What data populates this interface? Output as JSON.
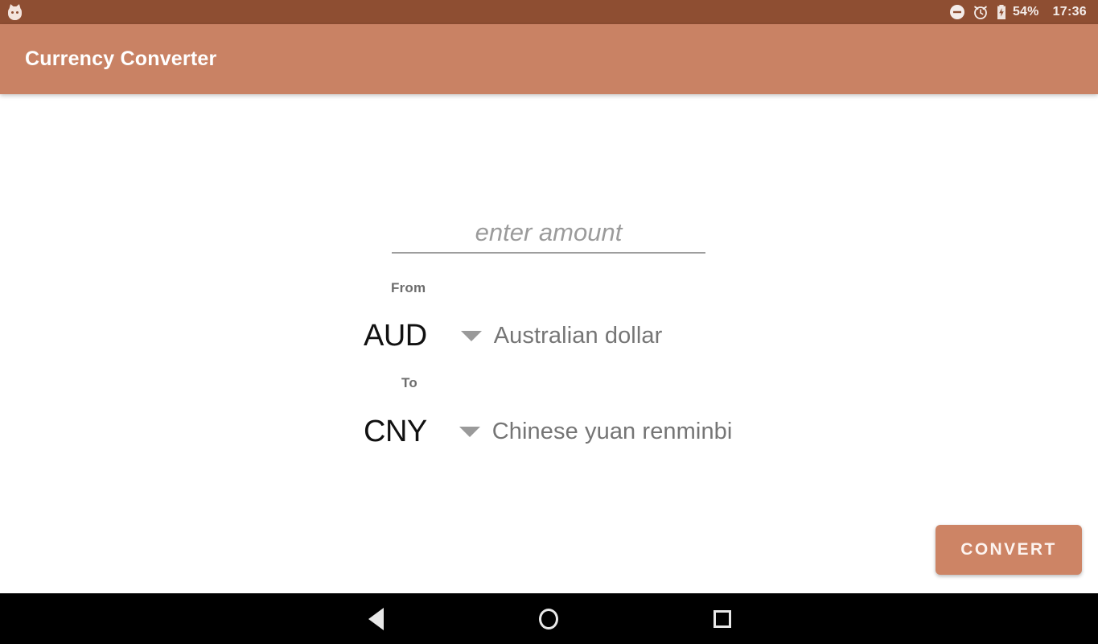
{
  "status_bar": {
    "notification_icon": "android-robot-icon",
    "dnd_icon": "do-not-disturb-icon",
    "alarm_icon": "alarm-clock-icon",
    "battery_icon": "battery-charging-icon",
    "battery_percent": "54%",
    "time": "17:36",
    "background_color": "#8e4e32",
    "text_color": "#f4ece9"
  },
  "app_bar": {
    "title": "Currency Converter",
    "background_color": "#c98264",
    "title_color": "#ffffff"
  },
  "form": {
    "amount": {
      "value": "",
      "placeholder": "enter amount"
    },
    "from": {
      "label": "From",
      "code": "AUD",
      "name": "Australian dollar",
      "caret_icon": "chevron-down-icon"
    },
    "to": {
      "label": "To",
      "code": "CNY",
      "name": "Chinese yuan renminbi",
      "caret_icon": "chevron-down-icon"
    },
    "convert_label": "CONVERT",
    "convert_color": "#cd8465"
  },
  "nav_bar": {
    "back_icon": "back-triangle-icon",
    "home_icon": "home-circle-icon",
    "recents_icon": "recents-square-icon",
    "background_color": "#000000"
  }
}
